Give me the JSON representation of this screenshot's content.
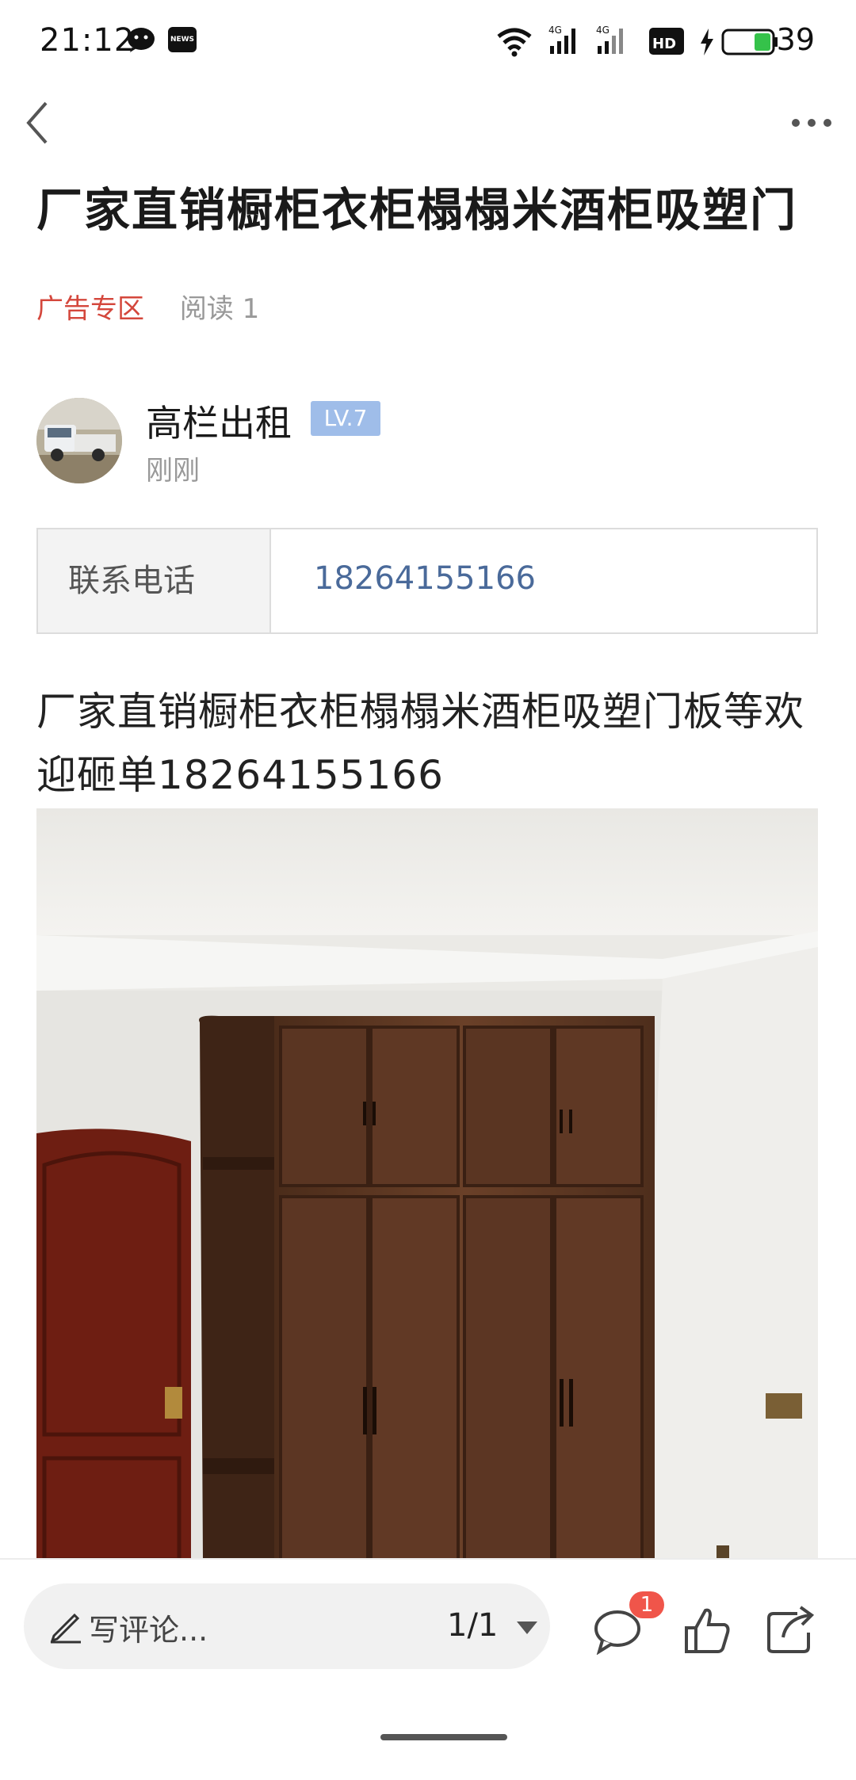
{
  "status_bar": {
    "time": "21:12",
    "news_badge": "NEWS",
    "battery_level": "39",
    "network": "4G",
    "hd_label": "HD"
  },
  "article": {
    "title": "厂家直销橱柜衣柜榻榻米酒柜吸塑门",
    "category": "广告专区",
    "reads": "阅读 1",
    "body": "厂家直销橱柜衣柜榻榻米酒柜吸塑门板等欢迎砸单18264155166"
  },
  "author": {
    "name": "高栏出租",
    "level": "LV.7",
    "time": "刚刚"
  },
  "contact": {
    "label": "联系电话",
    "value": "18264155166"
  },
  "bottom_bar": {
    "comment_placeholder": "写评论...",
    "page_indicator": "1/1",
    "comment_count": "1"
  },
  "colors": {
    "category_red": "#d4473c",
    "badge_blue": "#9fbde9",
    "phone_link": "#4a6a9a",
    "notification_red": "#f0554a"
  },
  "icons": [
    "back-icon",
    "more-icon",
    "pencil-icon",
    "comment-icon",
    "like-icon",
    "share-icon",
    "wifi-icon",
    "signal-icon",
    "battery-icon",
    "wechat-icon",
    "news-icon"
  ]
}
